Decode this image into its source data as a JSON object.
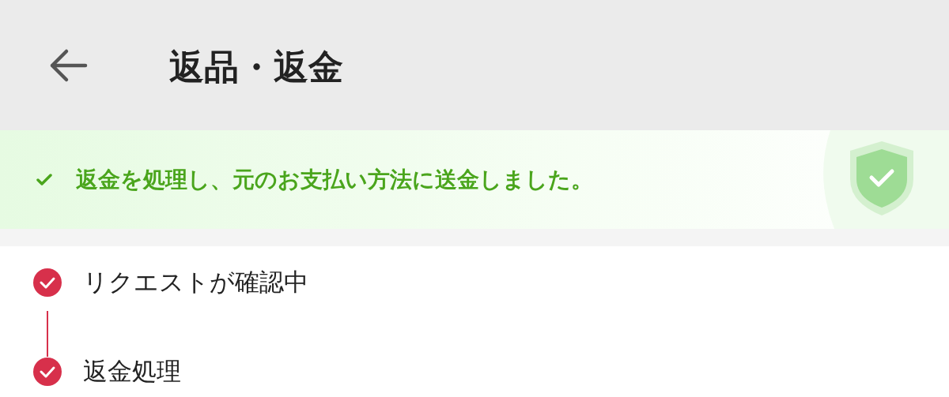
{
  "header": {
    "title": "返品・返金"
  },
  "banner": {
    "message": "返金を処理し、元のお支払い方法に送金しました。"
  },
  "steps": [
    {
      "label": "リクエストが確認中",
      "done": true
    },
    {
      "label": "返金処理",
      "done": true
    }
  ]
}
